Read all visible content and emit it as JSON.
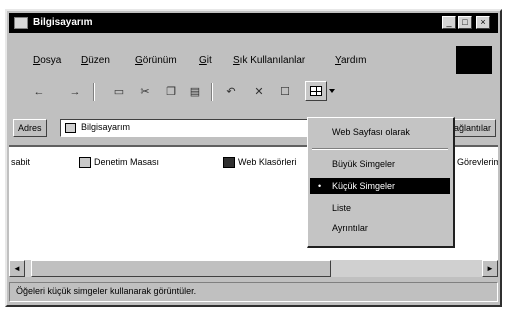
{
  "window": {
    "title": "Bilgisayarım"
  },
  "title_buttons": {
    "minimize": "_",
    "maximize": "□",
    "close": "×"
  },
  "menubar": {
    "items": [
      {
        "accel": "D",
        "rest": "osya"
      },
      {
        "accel": "D",
        "rest": "üzen"
      },
      {
        "accel": "G",
        "rest": "örünüm"
      },
      {
        "accel": "G",
        "rest": "it"
      },
      {
        "accel": "S",
        "rest": "ık Kullanılanlar"
      },
      {
        "accel": "Y",
        "rest": "ardım"
      }
    ]
  },
  "address": {
    "label": "Adres",
    "value": "Bilgisayarım",
    "links_label": "Bağlantılar"
  },
  "files": [
    {
      "label": "sabit",
      "icon": "drive-icon"
    },
    {
      "label": "Denetim Masası",
      "icon": "control-panel-icon"
    },
    {
      "label": "Web Klasörleri",
      "icon": "web-folders-icon"
    },
    {
      "label": "Görevlerim",
      "icon": "tasks-icon"
    }
  ],
  "views_menu": {
    "items": [
      {
        "label": "Web Sayfası olarak",
        "selected": false,
        "bullet": false
      },
      {
        "label": "Büyük Simgeler",
        "selected": false,
        "bullet": false
      },
      {
        "label": "Küçük Simgeler",
        "selected": true,
        "bullet": true
      },
      {
        "label": "Liste",
        "selected": false,
        "bullet": false
      },
      {
        "label": "Ayrıntılar",
        "selected": false,
        "bullet": false
      }
    ],
    "bullet_char": "•"
  },
  "statusbar": {
    "text": "Öğeleri küçük simgeler kullanarak görüntüler."
  },
  "scrollbar": {
    "left_arrow": "◄",
    "right_arrow": "►"
  },
  "toolbar": {
    "buttons": [
      "back-icon",
      "forward-icon",
      "up-icon",
      "cut-icon",
      "copy-icon",
      "paste-icon",
      "undo-icon",
      "delete-icon",
      "properties-icon",
      "views-icon"
    ]
  },
  "colors": {
    "titlebar": "#000000",
    "chrome": "#c0c0c0",
    "selection": "#000000"
  }
}
